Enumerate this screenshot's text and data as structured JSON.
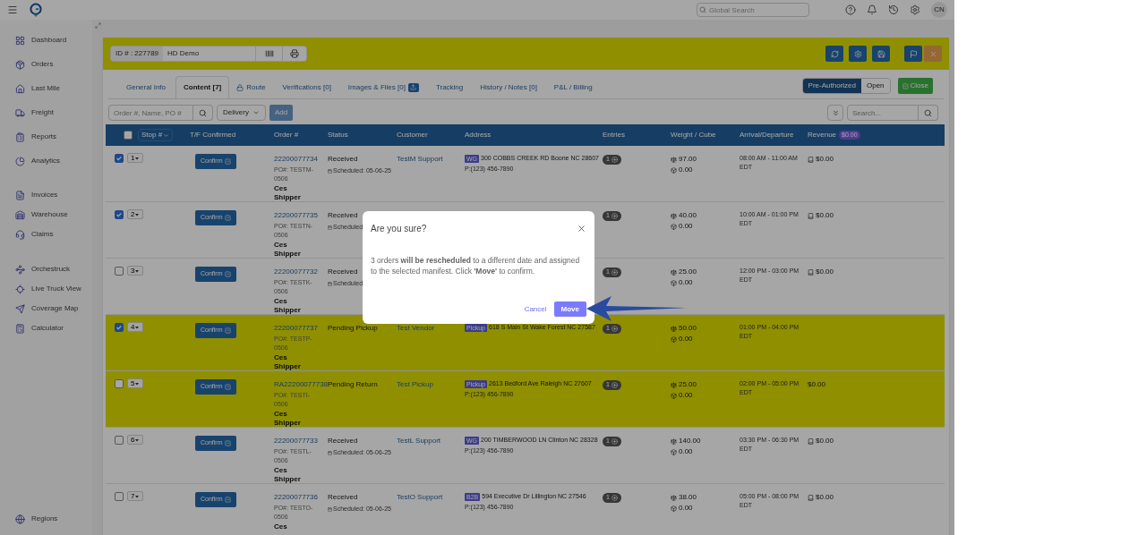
{
  "top_bar": {
    "search_placeholder": "Global Search",
    "avatar": "CN"
  },
  "sidebar": {
    "sections": [
      {
        "items": [
          "Dashboard",
          "Orders",
          "Last Mile",
          "Freight",
          "Reports",
          "Analytics"
        ]
      },
      {
        "items": [
          "Invoices",
          "Warehouse",
          "Claims"
        ]
      },
      {
        "items": [
          "Orchestruck",
          "Live Truck View",
          "Coverage Map",
          "Calculator"
        ]
      }
    ],
    "footer_item": "Regions"
  },
  "manifest": {
    "id_label": "ID # : 227789",
    "name": "HD Demo",
    "tabs": [
      {
        "label": "General Info",
        "selected": false,
        "kind": "plain"
      },
      {
        "label": "Content [7]",
        "selected": true,
        "kind": "plain"
      },
      {
        "label": "Route",
        "selected": false,
        "kind": "locked"
      },
      {
        "label": "Verifications [0]",
        "selected": false,
        "kind": "plain"
      },
      {
        "label": "Images & Files [0]",
        "selected": false,
        "kind": "upload"
      },
      {
        "label": "Tracking",
        "selected": false,
        "kind": "plain"
      },
      {
        "label": "History / Notes [0]",
        "selected": false,
        "kind": "plain"
      },
      {
        "label": "P&L / Billing",
        "selected": false,
        "kind": "plain"
      }
    ],
    "status_toggle": [
      {
        "label": "Pre-Authorized",
        "selected": true
      },
      {
        "label": "Open",
        "selected": false
      }
    ],
    "close_button": "Close",
    "filter": {
      "placeholder": "Order #, Name, PO #",
      "type": "Delivery",
      "add": "Add",
      "search_placeholder": "Search..."
    },
    "table": {
      "select_all": false,
      "columns": [
        "Stop #",
        "T/F Confirmed",
        "Order #",
        "Status",
        "Customer",
        "Address",
        "Entries",
        "Weight / Cube",
        "Arrival/Departure",
        "Revenue"
      ],
      "revenue_total": "$0.00",
      "rows": [
        {
          "checked": true,
          "highlighted": false,
          "stop": "1",
          "confirm": "Confirm",
          "order": "22200077734",
          "po": "PO#: TESTM-0506",
          "shipper": "Ces Shipper",
          "status": "Received",
          "schedule": "Scheduled: 05-06-25",
          "customer": "TestM Support",
          "tag": "WG",
          "address": "300 COBBS CREEK RD Boone NC 28607",
          "phone": "P:(123) 456-7890",
          "entries": "1",
          "weight": "97.00",
          "cube": "0.00",
          "time": "08:00 AM - 11:00 AM",
          "zone": "EDT",
          "revenue": "$0.00",
          "revenue_icon": true
        },
        {
          "checked": true,
          "highlighted": false,
          "stop": "2",
          "confirm": "Confirm",
          "order": "22200077735",
          "po": "PO#: TESTN-0506",
          "shipper": "Ces Shipper",
          "status": "Received",
          "schedule": "Scheduled",
          "entries": "1",
          "weight": "40.00",
          "cube": "0.00",
          "time": "10:00 AM - 01:00 PM",
          "zone": "EDT",
          "revenue": "$0.00",
          "revenue_icon": true
        },
        {
          "checked": false,
          "highlighted": false,
          "stop": "3",
          "confirm": "Confirm",
          "order": "22200077732",
          "po": "PO#: TESTK-0506",
          "shipper": "Ces Shipper",
          "status": "Received",
          "schedule": "Scheduled",
          "entries": "1",
          "weight": "25.00",
          "cube": "0.00",
          "time": "12:00 PM - 03:00 PM",
          "zone": "EDT",
          "revenue": "$0.00",
          "revenue_icon": true
        },
        {
          "checked": true,
          "highlighted": true,
          "stop": "4",
          "confirm": "Confirm",
          "order": "22200077737",
          "po": "PO#: TESTP-0506",
          "shipper": "Ces Shipper",
          "status": "Pending Pickup",
          "customer": "Test Vendor",
          "tag": "Pickup",
          "address": "618 S Main St Wake Forest NC 27587",
          "entries": "1",
          "weight": "50.00",
          "cube": "0.00",
          "time": "01:00 PM - 04:00 PM",
          "zone": "EDT"
        },
        {
          "checked": false,
          "highlighted": true,
          "stop": "5",
          "confirm": "Confirm",
          "order": "RA22200077738",
          "po": "PO#: TESTI-0506",
          "shipper": "Ces Shipper",
          "status": "Pending Return",
          "customer": "Test Pickup",
          "tag": "Pickup",
          "address": "2613 Bedford Ave Raleigh NC 27607",
          "phone": "P:(123) 456-7890",
          "entries": "1",
          "weight": "25.00",
          "cube": "0.00",
          "time": "02:00 PM - 05:00 PM",
          "zone": "EDT",
          "revenue": "$0.00",
          "revenue_icon": false
        },
        {
          "checked": false,
          "highlighted": false,
          "stop": "6",
          "confirm": "Confirm",
          "order": "22200077733",
          "po": "PO#: TESTL-0506",
          "shipper": "Ces Shipper",
          "status": "Received",
          "schedule": "Scheduled: 05-06-25",
          "customer": "TestL Support",
          "tag": "WG",
          "address": "200 TIMBERWOOD LN Clinton NC 28328",
          "phone": "P:(123) 456-7890",
          "entries": "1",
          "weight": "140.00",
          "cube": "0.00",
          "time": "03:30 PM - 06:30 PM",
          "zone": "EDT",
          "revenue": "$0.00",
          "revenue_icon": true
        },
        {
          "checked": false,
          "highlighted": false,
          "stop": "7",
          "confirm": "Confirm",
          "order": "22200077736",
          "po": "PO#: TESTO-0506",
          "shipper": "Ces",
          "status": "Received",
          "schedule": "Scheduled: 05-06-25",
          "customer": "TestO Support",
          "tag": "B2B",
          "address": "594 Executive Dr Lillington NC 27546",
          "phone": "P:(123) 456-7890",
          "entries": "1",
          "weight": "38.00",
          "cube": "0.00",
          "time": "05:00 PM - 08:00 PM",
          "zone": "EDT",
          "revenue": "$0.00",
          "revenue_icon": true
        }
      ]
    }
  },
  "dialog": {
    "title": "Are you sure?",
    "message": "3 orders **will be rescheduled** to a different date and assigned to the selected manifest. Click **'Move'** to confirm.",
    "cancel": "Cancel",
    "confirm": "Move"
  }
}
